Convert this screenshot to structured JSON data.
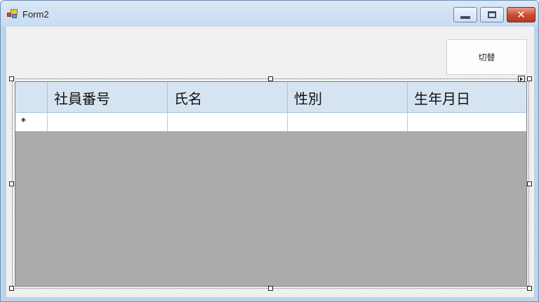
{
  "window": {
    "title": "Form2",
    "buttons": {
      "minimize": "minimize",
      "maximize": "maximize",
      "close": "✕"
    }
  },
  "form": {
    "switch_button_label": "切替"
  },
  "grid": {
    "columns": [
      "社員番号",
      "氏名",
      "性別",
      "生年月日"
    ],
    "new_row_marker": "*"
  },
  "colors": {
    "titlebar": "#c7dbf1",
    "client_background": "#f0f0f0",
    "grid_background": "#ababab",
    "header_background": "#d6e4f2",
    "close_button": "#c84a2f"
  },
  "icons": {
    "app": "windows-form-icon",
    "minimize": "minimize-icon",
    "maximize": "maximize-icon",
    "close": "close-icon",
    "smart_tag": "smart-tag-arrow-icon"
  }
}
